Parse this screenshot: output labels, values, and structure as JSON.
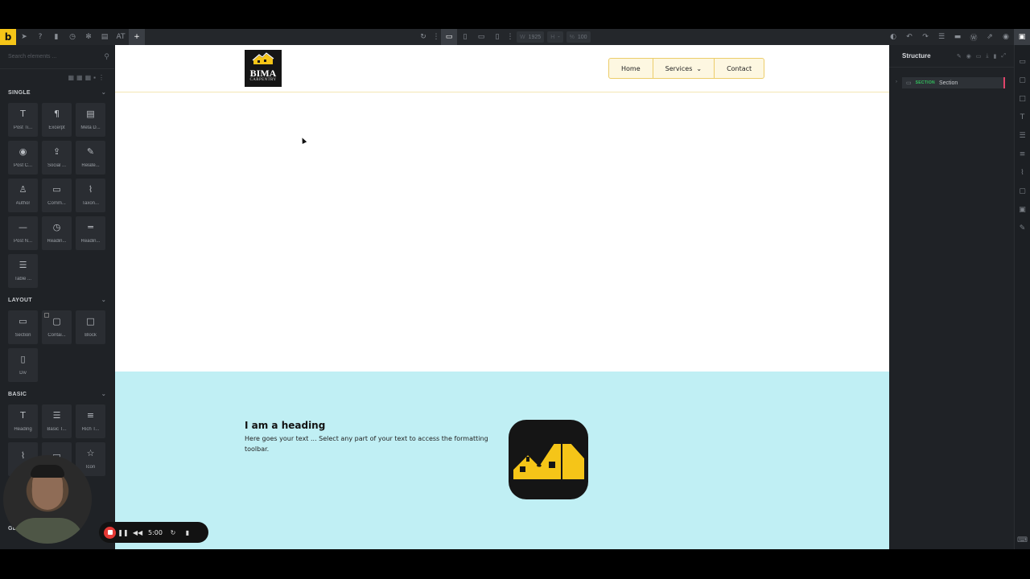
{
  "toolbar": {
    "logo": "b",
    "left_icons": [
      "cursor-icon",
      "help-icon",
      "trash-icon",
      "history-icon",
      "settings-icon",
      "page-icon"
    ],
    "at_label": "AT",
    "add_label": "+",
    "width_label": "W",
    "width_value": "1925",
    "height_label": "H",
    "height_value": "-",
    "zoom_label": "%",
    "zoom_value": "100"
  },
  "left_panel": {
    "search_placeholder": "Search elements ...",
    "categories": [
      {
        "name": "SINGLE",
        "items": [
          {
            "icon": "T",
            "label": "Post Ti..."
          },
          {
            "icon": "¶",
            "label": "Excerpt"
          },
          {
            "icon": "▤",
            "label": "Meta D..."
          },
          {
            "icon": "◉",
            "label": "Post C..."
          },
          {
            "icon": "⇪",
            "label": "Social ..."
          },
          {
            "icon": "✎",
            "label": "Relate..."
          },
          {
            "icon": "♙",
            "label": "Author"
          },
          {
            "icon": "▭",
            "label": "Comm..."
          },
          {
            "icon": "⌇",
            "label": "Taxon..."
          },
          {
            "icon": "—",
            "label": "Post N..."
          },
          {
            "icon": "◷",
            "label": "Readin..."
          },
          {
            "icon": "═",
            "label": "Readin..."
          },
          {
            "icon": "☰",
            "label": "Table ..."
          }
        ]
      },
      {
        "name": "LAYOUT",
        "items": [
          {
            "icon": "▭",
            "label": "Section"
          },
          {
            "icon": "▢",
            "label": "Contai..."
          },
          {
            "icon": "□",
            "label": "Block"
          },
          {
            "icon": "▯",
            "label": "Div"
          }
        ]
      },
      {
        "name": "BASIC",
        "items": [
          {
            "icon": "T",
            "label": "Heading"
          },
          {
            "icon": "☰",
            "label": "Basic T..."
          },
          {
            "icon": "≡",
            "label": "Rich T..."
          },
          {
            "icon": "⌇",
            "label": ""
          },
          {
            "icon": "▭",
            "label": ""
          },
          {
            "icon": "☆",
            "label": "Icon"
          }
        ]
      }
    ],
    "general_label": "GENE"
  },
  "site": {
    "logo_line1": "BIMA",
    "logo_line2": "CARPENTRY",
    "nav": [
      "Home",
      "Services",
      "Contact"
    ],
    "heading": "I am a heading",
    "paragraph": "Here goes your text ... Select any part of your text to access the formatting toolbar.",
    "accent": "#f5c518",
    "section_bg": "#c0eff4"
  },
  "right_panel": {
    "title": "Structure",
    "row_tag": "SECTION",
    "row_name": "Section"
  },
  "recorder": {
    "time": "5:00"
  }
}
